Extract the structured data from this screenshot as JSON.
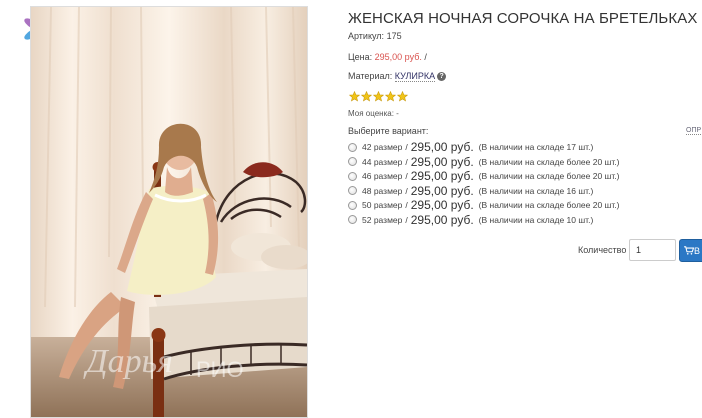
{
  "product": {
    "title": "ЖЕНСКАЯ НОЧНАЯ СОРОЧКА НА БРЕТЕЛЬКАХ",
    "article_label": "Артикул:",
    "article_value": "175",
    "price_label": "Цена:",
    "price_value": "295,00 руб.",
    "price_suffix": "/",
    "material_label": "Материал:",
    "material_value": "КУЛИРКА",
    "help_glyph": "?",
    "rating_stars": 5,
    "my_rating": "Моя оценка: -",
    "choose_variant": "Выберите вариант:",
    "table_link": "ОПР",
    "watermark": "Дарья РИО",
    "logo": "flower-logo",
    "star_color": "#f0c419",
    "accent_color": "#2b78c5",
    "price_color": "#d9534f"
  },
  "variants": [
    {
      "size": "42 размер",
      "sep": "/",
      "price": "295,00 руб.",
      "stock": "(В наличии на складе 17 шт.)"
    },
    {
      "size": "44 размер",
      "sep": "/",
      "price": "295,00 руб.",
      "stock": "(В наличии на складе более 20 шт.)"
    },
    {
      "size": "46 размер",
      "sep": "/",
      "price": "295,00 руб.",
      "stock": "(В наличии на складе более 20 шт.)"
    },
    {
      "size": "48 размер",
      "sep": "/",
      "price": "295,00 руб.",
      "stock": "(В наличии на складе 16 шт.)"
    },
    {
      "size": "50 размер",
      "sep": "/",
      "price": "295,00 руб.",
      "stock": "(В наличии на складе более 20 шт.)"
    },
    {
      "size": "52 размер",
      "sep": "/",
      "price": "295,00 руб.",
      "stock": "(В наличии на складе 10 шт.)"
    }
  ],
  "cart": {
    "quantity_label": "Количество",
    "quantity_value": "1",
    "buy_button_label": "В",
    "cart_icon": "cart-icon"
  }
}
